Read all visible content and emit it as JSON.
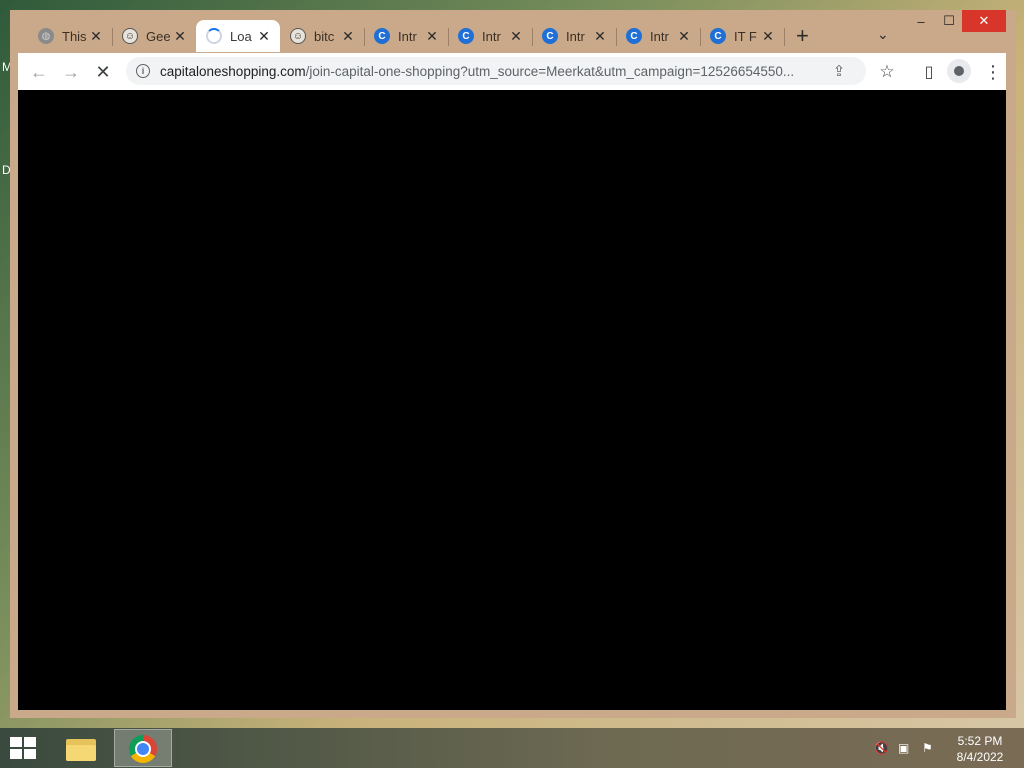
{
  "desktop": {
    "glyph_top": "M",
    "glyph_mid": "D"
  },
  "window": {
    "tabs": [
      {
        "title": "This",
        "favicon": "globe-icon"
      },
      {
        "title": "Gee",
        "favicon": "troll-face-icon"
      },
      {
        "title": "Loa",
        "favicon": "loading-spinner-icon",
        "active": true
      },
      {
        "title": "bitc",
        "favicon": "troll-face-icon"
      },
      {
        "title": "Intr",
        "favicon": "capital-one-c-icon"
      },
      {
        "title": "Intr",
        "favicon": "capital-one-c-icon"
      },
      {
        "title": "Intr",
        "favicon": "capital-one-c-icon"
      },
      {
        "title": "Intr",
        "favicon": "capital-one-c-icon"
      },
      {
        "title": "IT F",
        "favicon": "capital-one-c-icon"
      }
    ],
    "controls": {
      "minimize": "–",
      "maximize": "☐",
      "close": "✕"
    },
    "new_tab": "+",
    "tab_search": "⌄"
  },
  "toolbar": {
    "url_host": "capitaloneshopping.com",
    "url_rest": "/join-capital-one-shopping?utm_source=Meerkat&utm_campaign=12526654550...",
    "back": "←",
    "forward": "→",
    "stop": "✕",
    "share": "⇪",
    "bookmark": "☆",
    "sidepanel": "▯",
    "menu": "⋮"
  },
  "taskbar": {
    "time": "5:52 PM",
    "date": "8/4/2022"
  },
  "colors": {
    "frame": "#c9a989",
    "close": "#d9362b",
    "content": "#000000"
  }
}
